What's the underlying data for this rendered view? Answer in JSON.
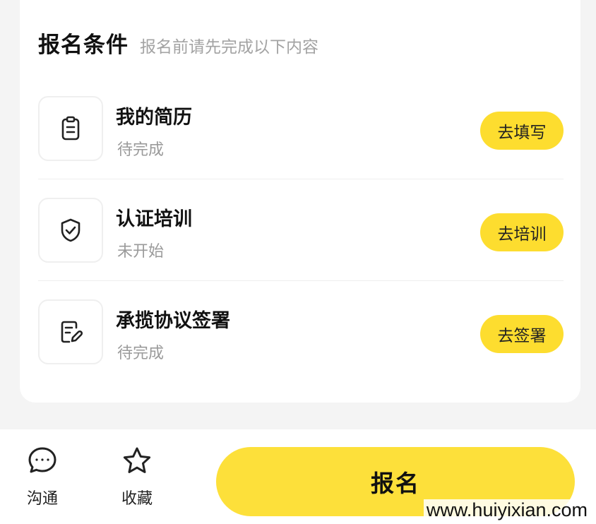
{
  "section": {
    "title": "报名条件",
    "subtitle": "报名前请先完成以下内容"
  },
  "requirements": [
    {
      "icon": "clipboard-icon",
      "title": "我的简历",
      "status": "待完成",
      "action": "去填写"
    },
    {
      "icon": "shield-check-icon",
      "title": "认证培训",
      "status": "未开始",
      "action": "去培训"
    },
    {
      "icon": "document-edit-icon",
      "title": "承揽协议签署",
      "status": "待完成",
      "action": "去签署"
    }
  ],
  "bottom_bar": {
    "chat_label": "沟通",
    "favorite_label": "收藏",
    "signup_label": "报名"
  },
  "watermark": "www.huiyixian.com",
  "colors": {
    "accent": "#fddd2f",
    "background": "#f4f4f4",
    "muted_text": "#9a9a9a"
  }
}
